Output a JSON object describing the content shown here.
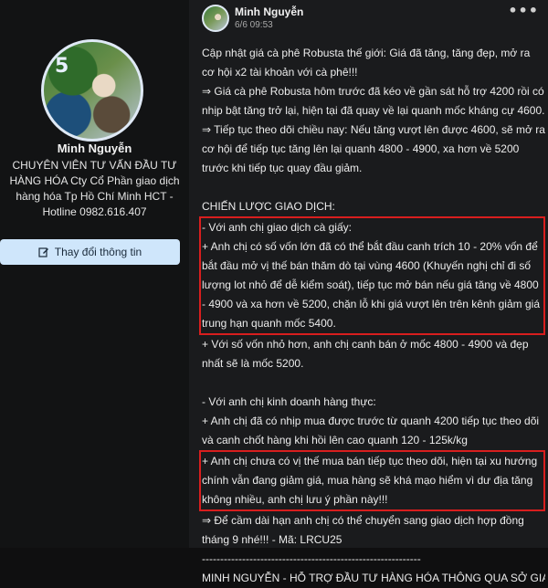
{
  "profile": {
    "avatar_text": "5",
    "name": "Minh Nguyễn",
    "description": "CHUYÊN VIÊN TƯ VẤN ĐẦU TƯ HÀNG HÓA Cty Cổ Phần giao dịch hàng hóa Tp Hồ Chí Minh HCT - Hotline 0982.616.407",
    "edit_button": "Thay đổi thông tin"
  },
  "post": {
    "author": "Minh Nguyễn",
    "time": "6/6 09:53",
    "more": "•••",
    "lines": {
      "l1": "Cập nhật giá cà phê Robusta thế giới: Giá đã tăng, tăng đẹp, mở ra cơ hội x2 tài khoản với cà phê!!!",
      "l2": "⇒ Giá cà phê Robusta hôm trước đã kéo về gần sát hỗ trợ 4200 rồi có nhịp bật tăng trở lại, hiện tại đã quay về lại quanh mốc kháng cự 4600.",
      "l3": "⇒ Tiếp tục theo dõi chiều nay: Nếu tăng vượt lên được 4600, sẽ mở ra cơ hội để tiếp tục tăng lên lại quanh 4800 - 4900, xa hơn về 5200 trước khi tiếp tục quay đầu giảm.",
      "l4": "CHIẾN LƯỢC GIAO DỊCH:",
      "l5": "- Với anh chị giao dịch cà giấy:",
      "l6": "+ Anh chị có số vốn lớn đã có thể bắt đầu canh trích 10 - 20% vốn để bắt đầu mở vị thế bán thăm dò tại vùng 4600 (Khuyến nghị chỉ đi số lượng lot nhỏ để dễ kiểm soát), tiếp tục mở bán nếu giá tăng về 4800 - 4900 và xa hơn về 5200, chặn lỗ khi giá vượt lên trên kênh giảm giá trung hạn quanh mốc 5400.",
      "l7": "+ Với số vốn nhỏ hơn, anh chị canh bán ở mốc 4800 - 4900 và đẹp nhất sẽ là mốc 5200.",
      "l8": "- Với anh chị kinh doanh hàng thực:",
      "l9": "+ Anh chị đã có nhịp mua được trước từ quanh 4200 tiếp tục theo dõi và canh chốt hàng khi hồi lên cao quanh 120 - 125k/kg",
      "l10": "+ Anh chị chưa có vị thế mua bán tiếp tục theo dõi, hiện tại xu hướng chính vẫn đang giảm giá, mua hàng sẽ khá mạo hiểm vì dư địa tăng không nhiều, anh chị lưu ý phần này!!!",
      "l11": "⇒ Để cầm dài hạn anh chị có thể chuyển sang giao dịch hợp đồng tháng 9 nhé!!! - Mã: LRCU25",
      "l12": "------------------------------------------------------------",
      "l13": "MINH NGUYỄN - HỖ TRỢ ĐẦU TƯ HÀNG HÓA THÔNG QUA SỞ GIAO"
    }
  },
  "colors": {
    "highlight_border": "#d81e1e",
    "button_bg": "#cfe6fb"
  }
}
